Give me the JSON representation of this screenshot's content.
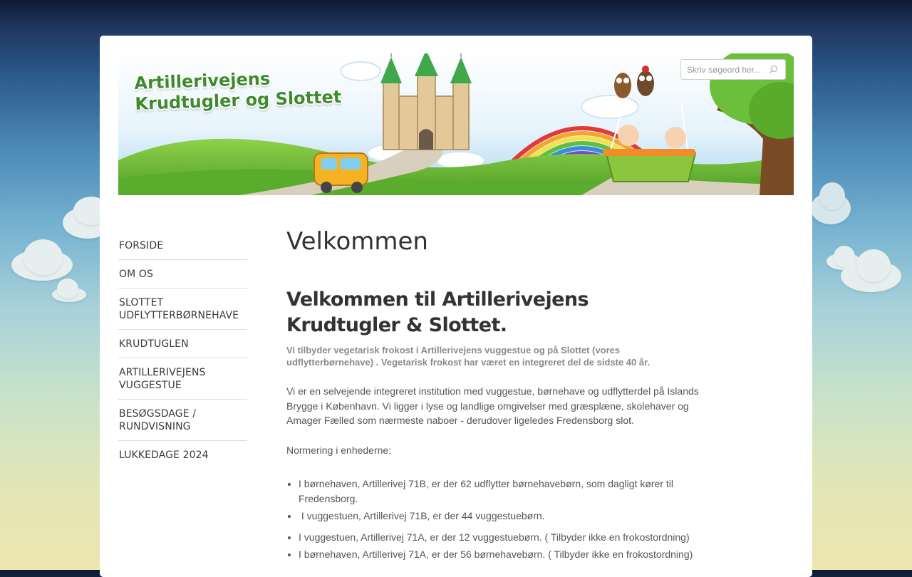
{
  "header": {
    "logo_line1": "Artillerivejens",
    "logo_line2": "Krudtugler og Slottet",
    "search_placeholder": "Skriv søgeord her..."
  },
  "nav": {
    "items": [
      "FORSIDE",
      "OM OS",
      "SLOTTET UDFLYTTERBØRNEHAVE",
      "KRUDTUGLEN",
      "ARTILLERIVEJENS VUGGESTUE",
      "BESØGSDAGE / RUNDVISNING",
      "LUKKEDAGE 2024"
    ]
  },
  "content": {
    "page_title": "Velkommen",
    "heading": "Velkommen til Artillerivejens Krudtugler & Slottet.",
    "intro_bold": "Vi tilbyder vegetarisk frokost i Artillerivejens vuggestue og på Slottet (vores udflytterbørnehave) . Vegetarisk frokost har været en integreret del de sidste 40 år.",
    "paragraph1": "Vi er en selvejende integreret institution med vuggestue, børnehave og udflytterdel på Islands Brygge i København. Vi ligger i lyse og landlige omgivelser med græsplæne, skolehaver og Amager Fælled som nærmeste naboer - derudover ligeledes Fredensborg slot.",
    "paragraph2": "Normering i enhederne:",
    "list": [
      "I børnehaven, Artillerivej 71B, er der 62 udflytter børnehavebørn, som dagligt kører til Fredensborg.",
      " I vuggestuen, Artillerivej 71B, er der 44 vuggestuebørn.",
      "I vuggestuen, Artillerivej 71A, er der 12 vuggestuebørn. ( Tilbyder ikke en frokostordning)",
      "I børnehaven, Artillerivej 71A, er der 56 børnehavebørn. ( Tilbyder ikke en frokostordning)"
    ]
  },
  "colors": {
    "logo_green": "#3f8a2e",
    "text": "#555555",
    "heading": "#333333",
    "muted_bold": "#8a8a8a"
  }
}
